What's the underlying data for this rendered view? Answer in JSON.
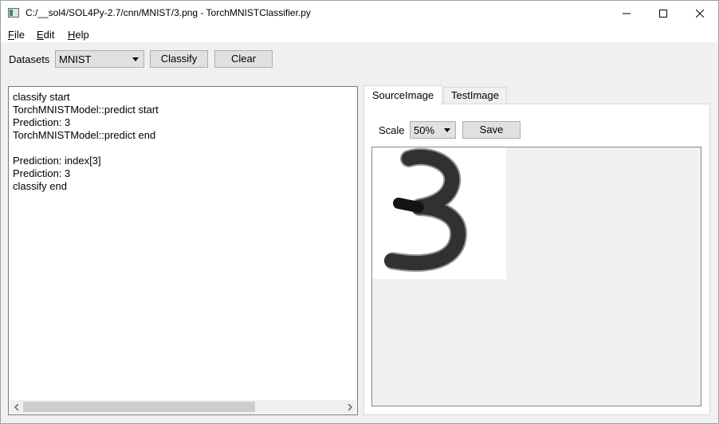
{
  "window": {
    "title": "C:/__sol4/SOL4Py-2.7/cnn/MNIST/3.png - TorchMNISTClassifier.py"
  },
  "menu": {
    "items": [
      {
        "mnemonic": "F",
        "rest": "ile"
      },
      {
        "mnemonic": "E",
        "rest": "dit"
      },
      {
        "mnemonic": "H",
        "rest": "elp"
      }
    ]
  },
  "toolbar": {
    "datasets_label": "Datasets",
    "datasets_value": "MNIST",
    "classify_label": "Classify",
    "clear_label": "Clear"
  },
  "log": {
    "lines": [
      "classify start",
      "TorchMNISTModel::predict start",
      "Prediction: 3",
      "TorchMNISTModel::predict end",
      "",
      "Prediction: index[3]",
      "Prediction: 3",
      "classify end"
    ]
  },
  "tabs": {
    "items": [
      "SourceImage",
      "TestImage"
    ],
    "active_index": 0
  },
  "image_panel": {
    "scale_label": "Scale",
    "scale_value": "50%",
    "save_label": "Save"
  },
  "icons": {
    "minimize": "minimize-icon",
    "maximize": "maximize-icon",
    "close": "close-icon",
    "dropdown": "chevron-down-icon"
  },
  "colors": {
    "window_bg": "#f0f0f0",
    "button_bg": "#e1e1e1",
    "digit_ink": "#111111"
  }
}
